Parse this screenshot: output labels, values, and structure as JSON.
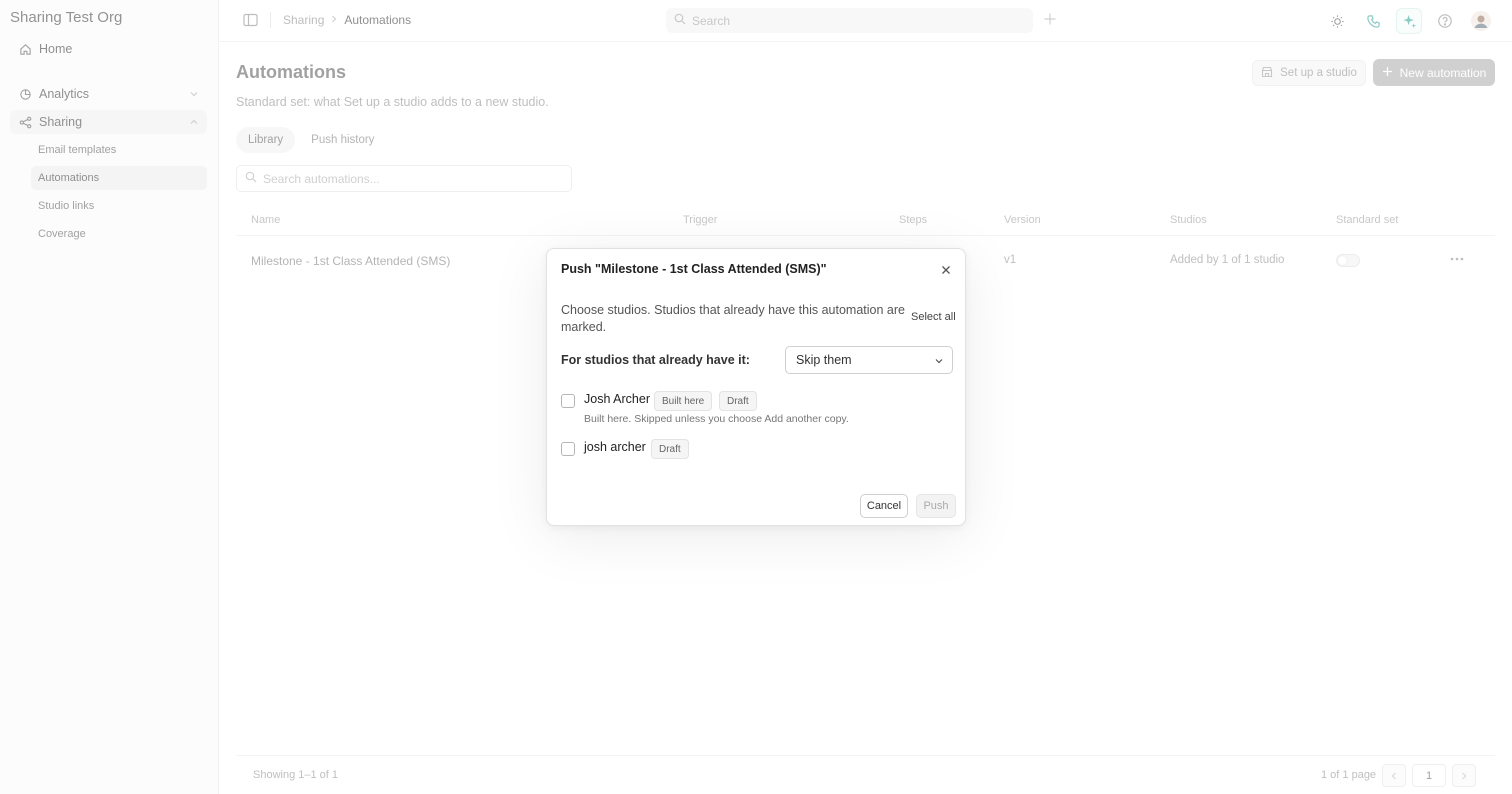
{
  "org": {
    "name": "Sharing Test Org"
  },
  "nav": {
    "home": "Home",
    "analytics": "Analytics",
    "sharing": "Sharing",
    "sharing_items": [
      "Email templates",
      "Automations",
      "Studio links",
      "Coverage"
    ]
  },
  "breadcrumb": {
    "parent": "Sharing",
    "current": "Automations"
  },
  "topbar": {
    "search_placeholder": "Search"
  },
  "page": {
    "title": "Automations",
    "subtitle": "Standard set: what Set up a studio adds to a new studio.",
    "setup_label": "Set up a studio",
    "new_label": "New automation"
  },
  "tabs": [
    "Library",
    "Push history"
  ],
  "search_automations": {
    "placeholder": "Search automations..."
  },
  "table": {
    "columns": [
      "Name",
      "Trigger",
      "Steps",
      "Version",
      "Studios",
      "Standard set"
    ],
    "rows": [
      {
        "name": "Milestone - 1st Class Attended (SMS)",
        "version": "v1",
        "studios": "Added by 1 of 1 studio",
        "standard_set": false
      }
    ]
  },
  "footer": {
    "showing": "Showing 1–1 of 1",
    "pages": "1 of 1 page",
    "current_page": "1"
  },
  "modal": {
    "title": "Push \"Milestone - 1st Class Attended (SMS)\"",
    "description": "Choose studios. Studios that already have this automation are marked.",
    "select_all": "Select all",
    "conflict_label": "For studios that already have it:",
    "conflict_value": "Skip them",
    "studios": [
      {
        "name": "Josh Archer",
        "badges": [
          "Built here",
          "Draft"
        ],
        "note": "Built here. Skipped unless you choose Add another copy."
      },
      {
        "name": "josh archer",
        "badges": [
          "Draft"
        ]
      }
    ],
    "cancel": "Cancel",
    "push": "Push"
  },
  "colors": {
    "accent": "#2aa198",
    "button_disabled": "#a9a9a9"
  }
}
